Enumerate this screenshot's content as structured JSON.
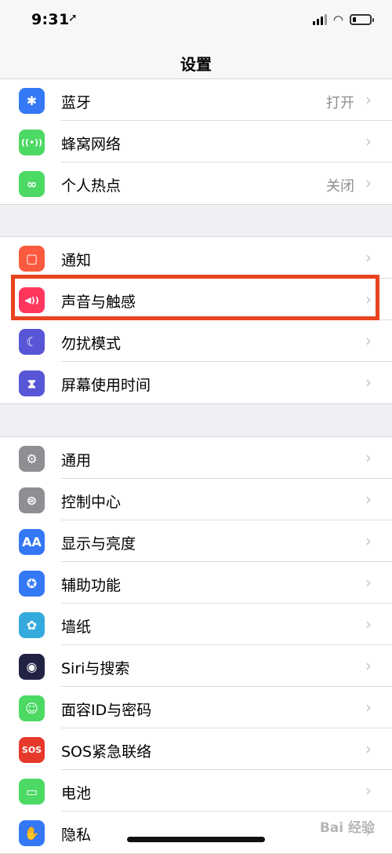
{
  "status_bar": {
    "time": "9:31",
    "location_icon": "arrow-icon"
  },
  "nav": {
    "title": "设置"
  },
  "groups": [
    {
      "items": [
        {
          "label": "蓝牙",
          "value": "打开",
          "icon": "bluetooth-icon",
          "color": "#3478f6",
          "glyph": "✱"
        },
        {
          "label": "蜂窝网络",
          "icon": "cellular-icon",
          "color": "#4cd964",
          "glyph": "((•))"
        },
        {
          "label": "个人热点",
          "value": "关闭",
          "icon": "hotspot-icon",
          "color": "#4cd964",
          "glyph": "∞"
        }
      ]
    },
    {
      "items": [
        {
          "label": "通知",
          "icon": "notification-icon",
          "color": "#fc5b3f",
          "glyph": "▢"
        },
        {
          "label": "声音与触感",
          "icon": "sound-icon",
          "color": "#ff375f",
          "glyph": "◀))"
        },
        {
          "label": "勿扰模式",
          "icon": "moon-icon",
          "color": "#5856d6",
          "glyph": "☾"
        },
        {
          "label": "屏幕使用时间",
          "icon": "hourglass-icon",
          "color": "#5856d6",
          "glyph": "⧗"
        }
      ]
    },
    {
      "items": [
        {
          "label": "通用",
          "icon": "gear-icon",
          "color": "#8e8e93",
          "glyph": "⚙"
        },
        {
          "label": "控制中心",
          "icon": "toggles-icon",
          "color": "#8e8e93",
          "glyph": "⊜"
        },
        {
          "label": "显示与亮度",
          "icon": "display-icon",
          "color": "#3478f6",
          "glyph": "AA"
        },
        {
          "label": "辅助功能",
          "icon": "accessibility-icon",
          "color": "#3478f6",
          "glyph": "✪"
        },
        {
          "label": "墙纸",
          "icon": "wallpaper-icon",
          "color": "#35aadc",
          "glyph": "✿"
        },
        {
          "label": "Siri与搜索",
          "icon": "siri-icon",
          "color": "#222244",
          "glyph": "◉"
        },
        {
          "label": "面容ID与密码",
          "icon": "faceid-icon",
          "color": "#4cd964",
          "glyph": "☺"
        },
        {
          "label": "SOS紧急联络",
          "icon": "sos-icon",
          "color": "#e6392b",
          "glyph": "SOS"
        },
        {
          "label": "电池",
          "icon": "battery-icon",
          "color": "#4cd964",
          "glyph": "▭"
        },
        {
          "label": "隐私",
          "icon": "hand-icon",
          "color": "#3478f6",
          "glyph": "✋"
        }
      ]
    }
  ],
  "chevron": "›",
  "watermark": "Bai 经验"
}
